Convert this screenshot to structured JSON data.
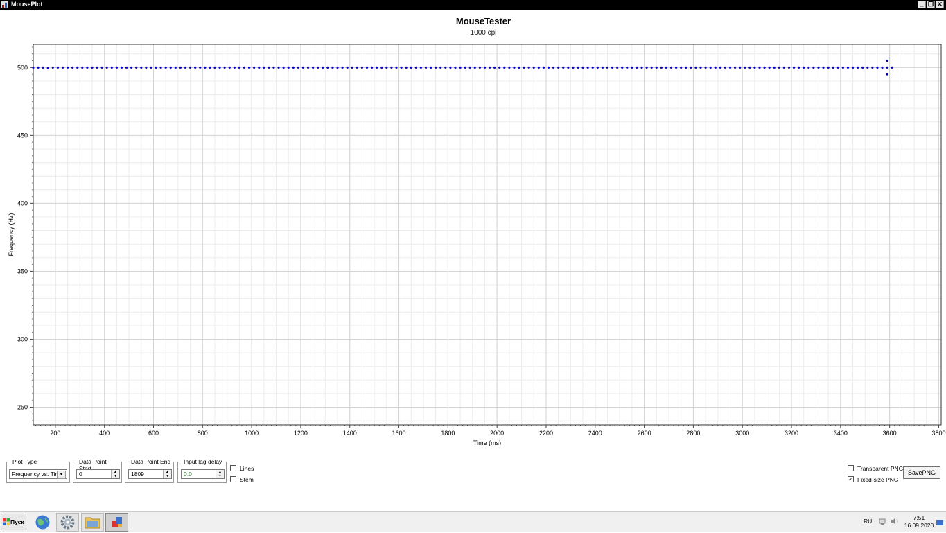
{
  "window": {
    "title": "MousePlot",
    "min_glyph": "_",
    "restore_glyph": "❐",
    "close_glyph": "✕"
  },
  "chart_data": {
    "type": "scatter",
    "title": "MouseTester",
    "subtitle": "1000 cpi",
    "xlabel": "Time (ms)",
    "ylabel": "Frequency (Hz)",
    "xlim": [
      110,
      3810
    ],
    "ylim": [
      237,
      517
    ],
    "xticks": [
      200,
      400,
      600,
      800,
      1000,
      1200,
      1400,
      1600,
      1800,
      2000,
      2200,
      2400,
      2600,
      2800,
      3000,
      3200,
      3400,
      3600,
      3800
    ],
    "yticks": [
      250,
      300,
      350,
      400,
      450,
      500
    ],
    "grid": true,
    "color": "#0000cc",
    "series": [
      {
        "x_start": 110,
        "x_end": 3620,
        "x_step": 20,
        "base_value": 500,
        "deviations": [
          [
            170,
            499.5
          ],
          [
            500,
            498.5
          ],
          [
            1320,
            498.5
          ],
          [
            2240,
            499.3
          ],
          [
            3200,
            500.5
          ],
          [
            3580,
            500.2
          ]
        ],
        "extra_points": [
          [
            3590,
            505
          ],
          [
            3590,
            495
          ]
        ]
      }
    ]
  },
  "controls": {
    "plot_type": {
      "label": "Plot Type",
      "value": "Frequency vs. Time"
    },
    "data_point_start": {
      "label": "Data Point Start",
      "value": "0"
    },
    "data_point_end": {
      "label": "Data Point End",
      "value": "1809"
    },
    "input_lag_delay": {
      "label": "Input lag delay",
      "value": "0.0"
    },
    "lines": {
      "label": "Lines",
      "checked": false
    },
    "stem": {
      "label": "Stem",
      "checked": false
    },
    "transparent_png": {
      "label": "Transparent PNG",
      "checked": false
    },
    "fixed_size_png": {
      "label": "Fixed-size PNG",
      "checked": true
    },
    "save_png": {
      "label": "SavePNG"
    }
  },
  "taskbar": {
    "start_label": "Пуск",
    "lang": "RU",
    "time": "7:51",
    "date": "16.09.2020"
  }
}
